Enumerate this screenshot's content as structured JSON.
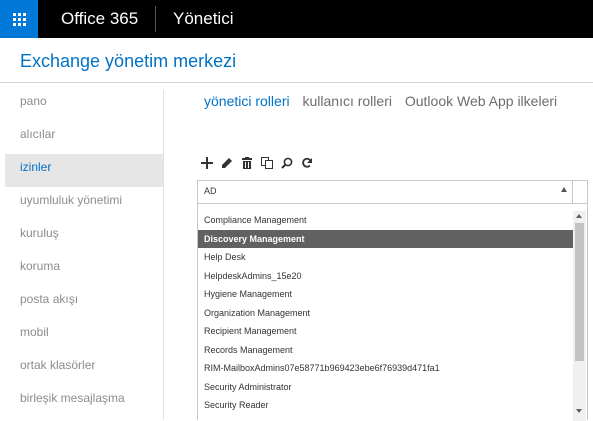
{
  "topbar": {
    "brand": "Office 365",
    "app": "Yönetici"
  },
  "header": {
    "title": "Exchange yönetim merkezi"
  },
  "nav": {
    "items": [
      {
        "label": "pano"
      },
      {
        "label": "alıcılar"
      },
      {
        "label": "izinler",
        "active": true
      },
      {
        "label": "uyumluluk yönetimi"
      },
      {
        "label": "kuruluş"
      },
      {
        "label": "koruma"
      },
      {
        "label": "posta akışı"
      },
      {
        "label": "mobil"
      },
      {
        "label": "ortak klasörler"
      },
      {
        "label": "birleşik mesajlaşma"
      }
    ]
  },
  "tabs": [
    {
      "label": "yönetici rolleri",
      "active": true
    },
    {
      "label": "kullanıcı rolleri"
    },
    {
      "label": "Outlook Web App ilkeleri"
    }
  ],
  "toolbar": {
    "icons": [
      "add-icon",
      "edit-icon",
      "delete-icon",
      "copy-icon",
      "search-icon",
      "refresh-icon"
    ]
  },
  "list": {
    "column": "AD",
    "rows": [
      "Compliance Management",
      "Discovery Management",
      "Help Desk",
      "HelpdeskAdmins_15e20",
      "Hygiene Management",
      "Organization Management",
      "Recipient Management",
      "Records Management",
      "RIM-MailboxAdmins07e58771b969423ebe6f76939d471fa1",
      "Security Administrator",
      "Security Reader"
    ],
    "selected_index": 1
  },
  "colors": {
    "accent": "#0072c6",
    "waffle": "#0078d7",
    "selected_row": "#616161"
  }
}
